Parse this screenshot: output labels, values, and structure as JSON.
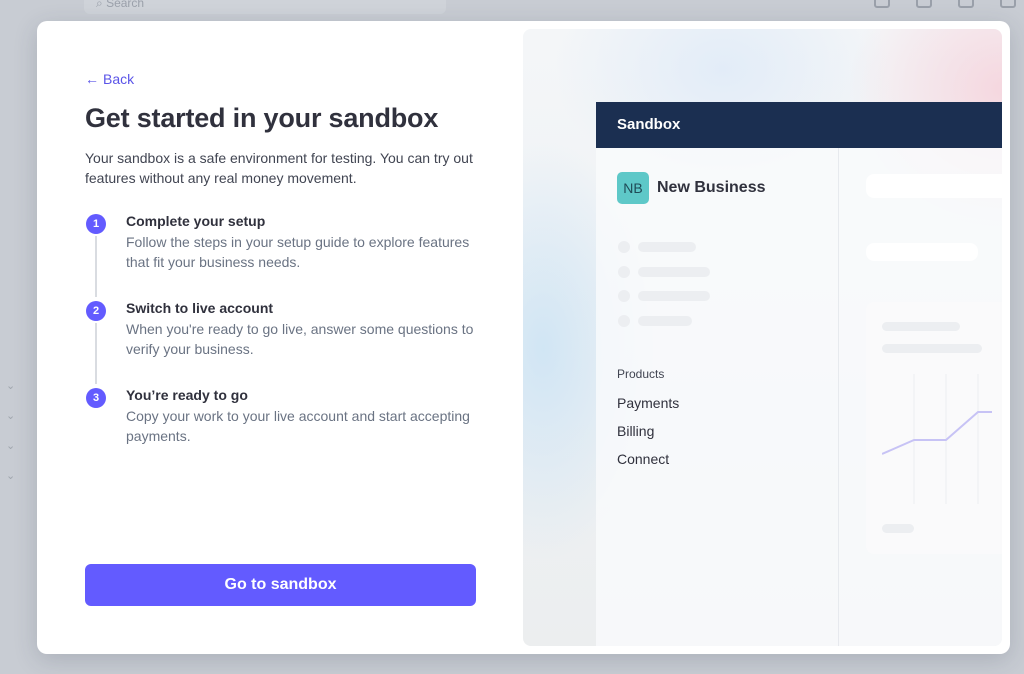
{
  "background": {
    "search_placeholder": "Search"
  },
  "modal": {
    "back_label": "Back",
    "title": "Get started in your sandbox",
    "intro": "Your sandbox is a safe environment for testing. You can try out features without any real money movement.",
    "steps": [
      {
        "number": "1",
        "title": "Complete your setup",
        "description": "Follow the steps in your setup guide to explore features that fit your business needs."
      },
      {
        "number": "2",
        "title": "Switch to live account",
        "description": "When you're ready to go live, answer some questions to verify your business."
      },
      {
        "number": "3",
        "title": "You’re ready to go",
        "description": "Copy your work to your live account and start accepting payments."
      }
    ],
    "cta_label": "Go to sandbox",
    "accent_color": "#635bff"
  },
  "preview": {
    "header_title": "Sandbox",
    "header_color": "#1b2f51",
    "business_initials": "NB",
    "business_name": "New Business",
    "products_label": "Products",
    "nav_items": [
      "Payments",
      "Billing",
      "Connect"
    ]
  }
}
